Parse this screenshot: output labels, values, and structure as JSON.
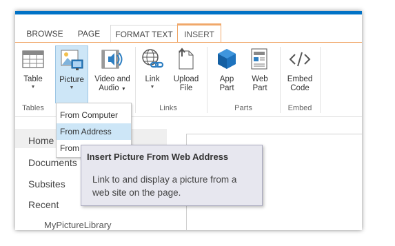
{
  "tabs": [
    {
      "label": "BROWSE"
    },
    {
      "label": "PAGE"
    },
    {
      "label": "FORMAT TEXT"
    },
    {
      "label": "INSERT",
      "active": true
    }
  ],
  "ribbon": {
    "groups": {
      "tables": "Tables",
      "links": "Links",
      "parts": "Parts",
      "embed": "Embed"
    },
    "buttons": {
      "table": "Table",
      "picture": "Picture",
      "video_audio_line1": "Video and",
      "video_audio_line2": "Audio",
      "link": "Link",
      "upload_line1": "Upload",
      "upload_line2": "File",
      "app_line1": "App",
      "app_line2": "Part",
      "web_line1": "Web",
      "web_line2": "Part",
      "embed_line1": "Embed",
      "embed_line2": "Code"
    }
  },
  "picture_menu": {
    "items": [
      {
        "label": "From Computer"
      },
      {
        "label": "From Address",
        "highlighted": true
      },
      {
        "label": "From SharePoint"
      }
    ]
  },
  "nav": {
    "items": [
      "Home",
      "Documents",
      "Subsites",
      "Recent"
    ],
    "sub_items": [
      "MyPictureLibrary"
    ]
  },
  "tooltip": {
    "title": "Insert Picture From Web Address",
    "body": "Link to and display a picture from a web site on the page."
  },
  "colors": {
    "accent_blue": "#0072c6",
    "insert_tab_orange": "#f0a86a",
    "hover_blue": "#cde6f7",
    "tooltip_bg": "#e7e7ef"
  }
}
